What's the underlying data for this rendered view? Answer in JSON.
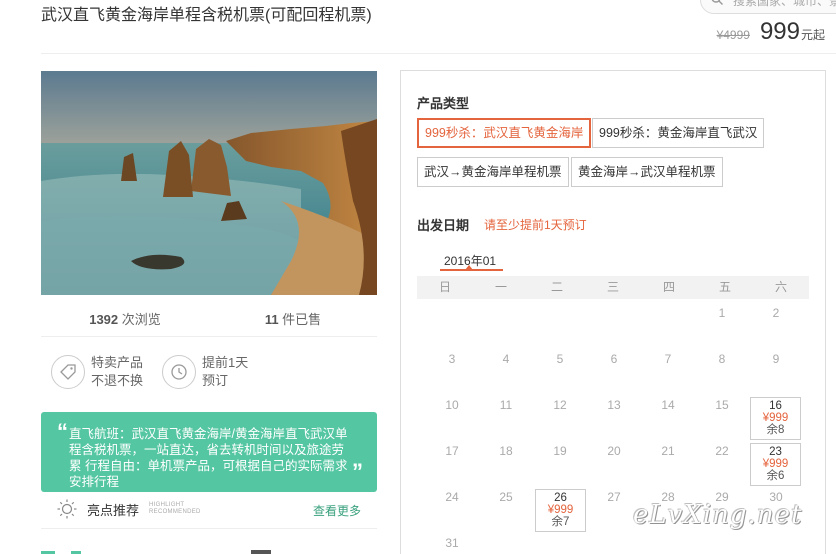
{
  "page": {
    "title": "武汉直飞黄金海岸单程含税机票(可配回程机票)"
  },
  "search": {
    "placeholder": "搜索国家、城市、景"
  },
  "price": {
    "original": "¥4999",
    "current": "999",
    "unit": "元起"
  },
  "stats": {
    "views_num": "1392",
    "views_label": " 次浏览",
    "sold_num": "11",
    "sold_label": " 件已售"
  },
  "features": [
    {
      "icon": "tag-icon",
      "line1": "特卖产品",
      "line2": "不退不换"
    },
    {
      "icon": "clock-icon",
      "line1": "提前1天",
      "line2": "预订"
    }
  ],
  "highlight": {
    "text": "直飞航班：武汉直飞黄金海岸/黄金海岸直飞武汉单程含税机票，一站直达，省去转机时间以及旅途劳累 行程自由：单机票产品，可根据自己的实际需求安排行程",
    "title": "亮点推荐",
    "en_line1": "HIGHLIGHT",
    "en_line2": "RECOMMENDED",
    "more": "查看更多"
  },
  "booking": {
    "product_type_label": "产品类型",
    "options": [
      "999秒杀：武汉直飞黄金海岸",
      "999秒杀：黄金海岸直飞武汉",
      "武汉→黄金海岸单程机票",
      "黄金海岸→武汉单程机票"
    ],
    "selected_option": 0,
    "date_label": "出发日期",
    "date_tip": "请至少提前1天预订",
    "month": "2016年01",
    "weekdays": [
      "日",
      "一",
      "二",
      "三",
      "四",
      "五",
      "六"
    ],
    "available": [
      {
        "day": "16",
        "price": "¥999",
        "remain": "余8"
      },
      {
        "day": "23",
        "price": "¥999",
        "remain": "余6"
      },
      {
        "day": "26",
        "price": "¥999",
        "remain": "余7"
      }
    ],
    "days": [
      "1",
      "2",
      "3",
      "4",
      "5",
      "6",
      "7",
      "8",
      "9",
      "10",
      "11",
      "12",
      "13",
      "14",
      "15",
      "17",
      "18",
      "19",
      "20",
      "21",
      "22",
      "24",
      "25",
      "27",
      "28",
      "29",
      "30",
      "31"
    ]
  },
  "watermark": "eLvXing.net",
  "colors": {
    "accent": "#e4643d",
    "green": "#55c6a2",
    "link_green": "#3aa17e"
  }
}
